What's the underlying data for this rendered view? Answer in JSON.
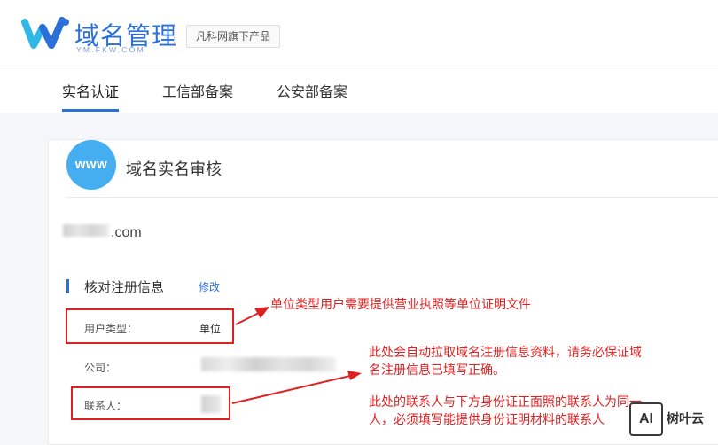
{
  "brand": {
    "title": "域名管理",
    "subtitle": "YM.FKW.COM",
    "tag": "凡科网旗下产品",
    "logo_icon": "w-logo-icon",
    "color": "#2b6fd8"
  },
  "tabs": [
    {
      "label": "实名认证",
      "active": true
    },
    {
      "label": "工信部备案",
      "active": false
    },
    {
      "label": "公安部备案",
      "active": false
    }
  ],
  "card": {
    "avatar_text": "www",
    "title": "域名实名审核",
    "domain_suffix": ".com",
    "section_title": "核对注册信息",
    "edit_label": "修改",
    "rows": [
      {
        "label": "用户类型：",
        "value": "单位"
      },
      {
        "label": "公司：",
        "value": ""
      },
      {
        "label": "联系人：",
        "value": ""
      }
    ]
  },
  "annotations": {
    "note1": "单位类型用户需要提供营业执照等单位证明文件",
    "note2_line1": "此处会自动拉取域名注册信息资料，请务必保证域",
    "note2_line2": "名注册信息已填写正确。",
    "note3_line1": "此处的联系人与下方身份证正面照的联系人为同一",
    "note3_line2": "人，必须填写能提供身份证明材料的联系人",
    "color": "#e02020"
  },
  "watermark": {
    "icon_text": "AI",
    "text": "树叶云"
  }
}
